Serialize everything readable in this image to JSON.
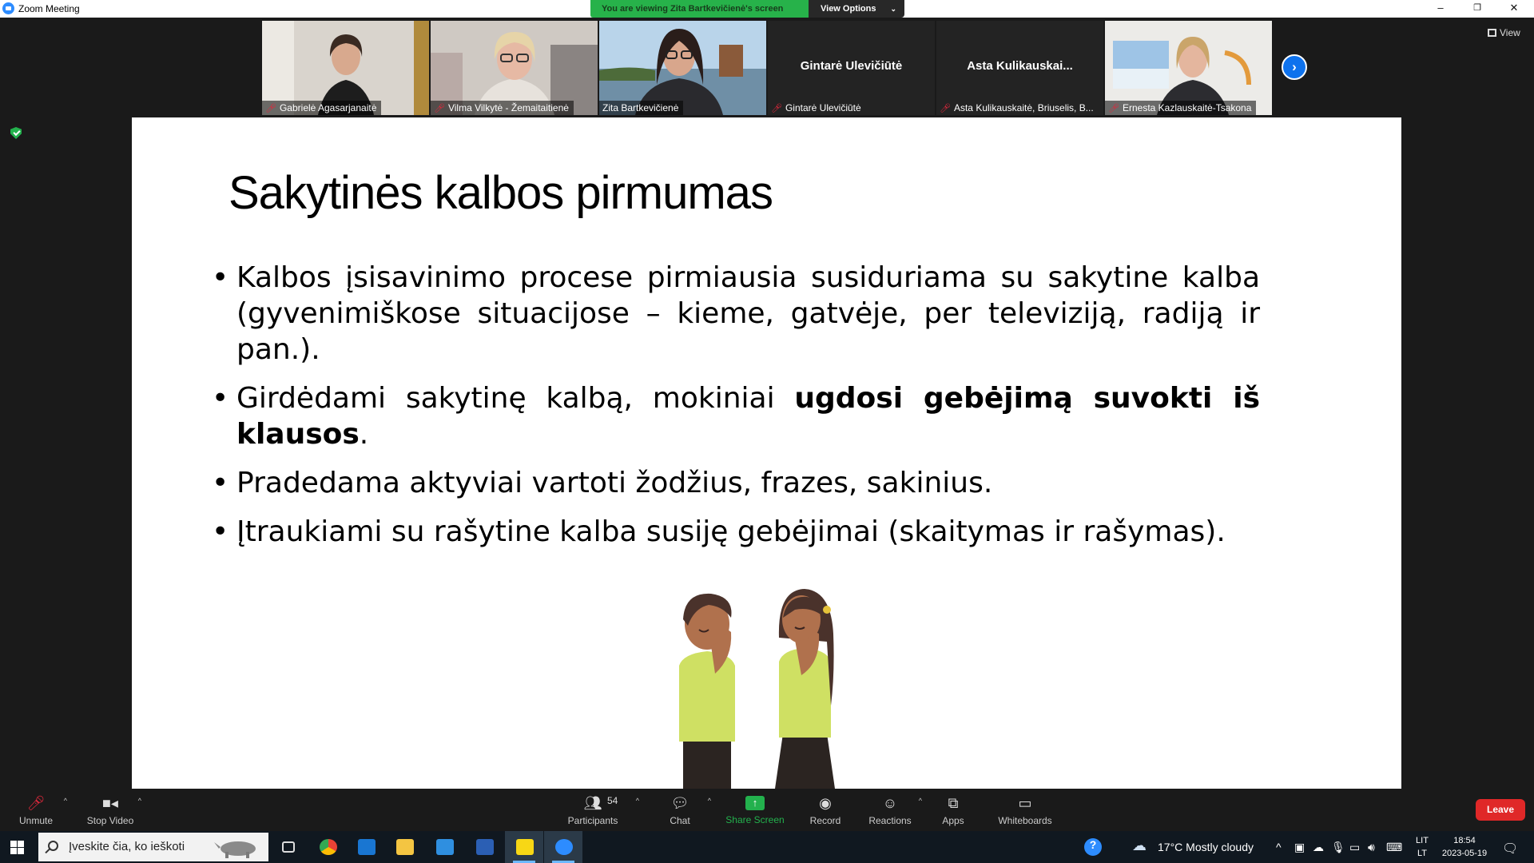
{
  "window": {
    "title": "Zoom Meeting",
    "minimize": "–",
    "restore": "❐",
    "close": "✕"
  },
  "banner": {
    "text": "You are viewing Zita Bartkevičienė's screen",
    "view_options": "View Options"
  },
  "gallery": {
    "tiles": [
      {
        "name": "Gabrielė Agasarjanaitė",
        "muted": true,
        "video": true
      },
      {
        "name": "Vilma Vilkytė - Žemaitaitienė",
        "muted": true,
        "video": true
      },
      {
        "name": "Zita Bartkevičienė",
        "muted": false,
        "video": true,
        "speaking": true
      },
      {
        "name": "Gintarė Ulevičiūtė",
        "display": "Gintarė Ulevičiūtė",
        "muted": true,
        "video": false
      },
      {
        "name": "Asta Kulikauskaitė, Briuselis, B...",
        "display": "Asta  Kulikauskai...",
        "muted": true,
        "video": false
      },
      {
        "name": "Ernesta Kazlauskaitė-Tsakona",
        "muted": true,
        "video": true
      }
    ],
    "view_label": "View"
  },
  "slide": {
    "title": "Sakytinės kalbos pirmumas",
    "bullets": [
      {
        "pre": "Kalbos įsisavinimo procese pirmiausia susiduriama su sakytine kalba (gyvenimiškose situacijose – kieme, gatvėje, per televiziją, radiją ir pan.).",
        "bold": "",
        "post": ""
      },
      {
        "pre": "Girdėdami sakytinę kalbą, mokiniai ",
        "bold": "ugdosi gebėjimą suvokti iš klausos",
        "post": "."
      },
      {
        "pre": "Pradedama aktyviai vartoti žodžius, frazes, sakinius.",
        "bold": "",
        "post": ""
      },
      {
        "pre": "Įtraukiami su rašytine kalba susiję gebėjimai (skaitymas ir rašymas).",
        "bold": "",
        "post": ""
      }
    ]
  },
  "toolbar": {
    "unmute": "Unmute",
    "stop_video": "Stop Video",
    "participants": "Participants",
    "participants_count": "54",
    "chat": "Chat",
    "share_screen": "Share Screen",
    "record": "Record",
    "reactions": "Reactions",
    "apps": "Apps",
    "whiteboards": "Whiteboards",
    "leave": "Leave"
  },
  "taskbar": {
    "search_placeholder": "Įveskite čia, ko ieškoti",
    "weather": "17°C  Mostly cloudy",
    "lang_top": "LIT",
    "lang_bottom": "LT",
    "time": "18:54",
    "date": "2023-05-19"
  },
  "colors": {
    "accent": "#0e72ed",
    "share_green": "#23b14d",
    "banner_green": "#27b24a",
    "leave_red": "#e02828",
    "speaker_outline": "#8bc34a"
  }
}
